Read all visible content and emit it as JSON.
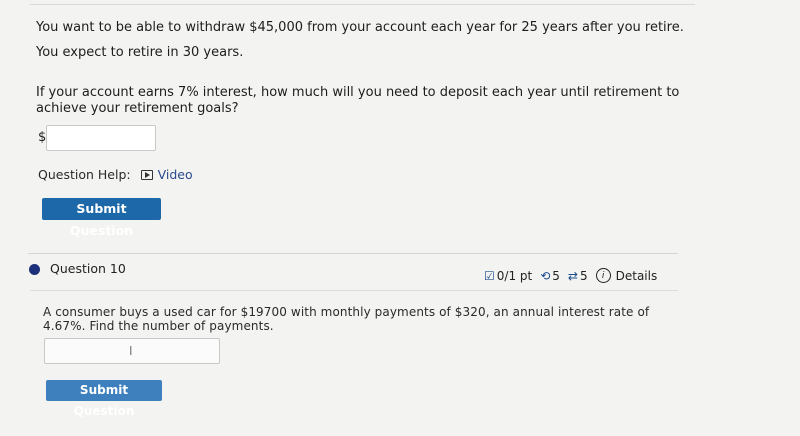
{
  "question9": {
    "line1": "You want to be able to withdraw $45,000 from your account each year for 25 years after you retire.",
    "line2": "You expect to retire in 30 years.",
    "line3": "If your account earns 7% interest, how much will you need to deposit each year until retirement to achieve your retirement goals?",
    "currency_symbol": "$",
    "answer_value": "",
    "help_label": "Question Help:",
    "video_label": "Video",
    "submit_label": "Submit Question"
  },
  "question10": {
    "title": "Question 10",
    "points": "0/1 pt",
    "retries": "5",
    "attempts": "5",
    "details_label": "Details",
    "text": "A consumer buys a used car for $19700 with monthly payments of $320, an annual interest rate of 4.67%. Find the number of payments.",
    "answer_value": "",
    "submit_label": "Submit Question"
  },
  "icons": {
    "video": "video-play-icon",
    "points": "checkbox-pen-icon",
    "retries": "retry-icon",
    "attempts": "sync-icon",
    "details": "info-icon"
  },
  "colors": {
    "button": "#1d68a8",
    "bullet": "#1c2f7a",
    "link": "#2b4a8e"
  }
}
